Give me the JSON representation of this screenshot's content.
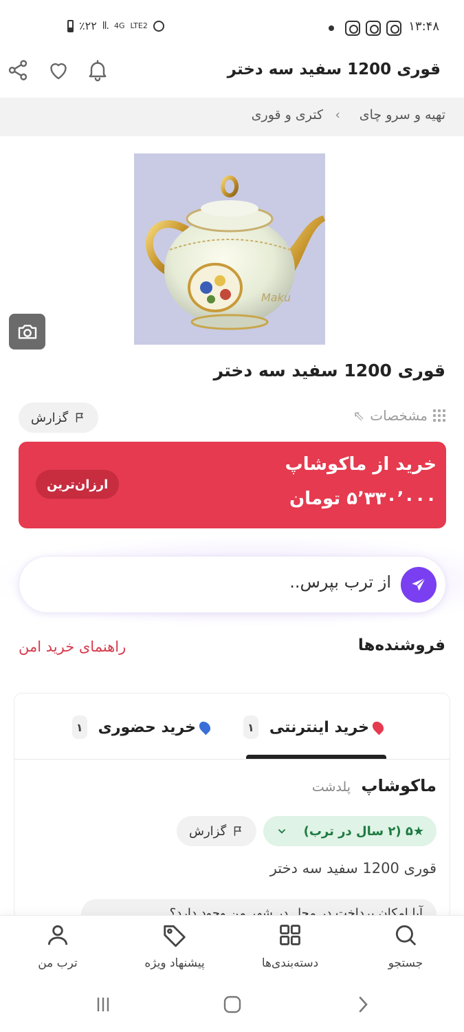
{
  "status_bar": {
    "time": "۱۳:۴۸",
    "battery": "٪۲۲",
    "network": "4G",
    "lte": "LTE2"
  },
  "header": {
    "title": "قوری 1200 سفید سه دختر"
  },
  "breadcrumb": {
    "items": [
      "تهیه و سرو چای",
      "کتری و قوری"
    ],
    "separator": "›"
  },
  "product": {
    "title": "قوری 1200 سفید سه دختر",
    "specs_label": "مشخصات",
    "report_label": "گزارش",
    "image_watermark": "Maku"
  },
  "buy_card": {
    "title": "خرید از ماکوشاپ",
    "price": "۵٬۳۳۰٬۰۰۰ تومان",
    "badge": "ارزان‌ترین",
    "color": "#e53a4f"
  },
  "ask": {
    "placeholder": "از ترب بپرس..",
    "accent": "#7a3ff0"
  },
  "sellers": {
    "title": "فروشنده‌ها",
    "safe_guide": "راهنمای خرید امن",
    "tabs": [
      {
        "label": "خرید اینترنتی",
        "count": "۱",
        "pin_color": "#e53a4f"
      },
      {
        "label": "خرید حضوری",
        "count": "۱",
        "pin_color": "#3b6fd8"
      }
    ],
    "shop": {
      "name": "ماکوشاپ",
      "city": "پلدشت",
      "rating": "★۵ (۲ سال در ترب)",
      "report_label": "گزارش",
      "product_name": "قوری 1200 سفید سه دختر",
      "faq": "آیا امکان پرداخت در محل در شهر من وجود دارد؟"
    }
  },
  "bottom_nav": [
    {
      "label": "جستجو",
      "icon": "search-icon"
    },
    {
      "label": "دسته‌بندی‌ها",
      "icon": "grid-icon"
    },
    {
      "label": "پیشنهاد ویژه",
      "icon": "tag-icon"
    },
    {
      "label": "ترب من",
      "icon": "user-icon"
    }
  ]
}
